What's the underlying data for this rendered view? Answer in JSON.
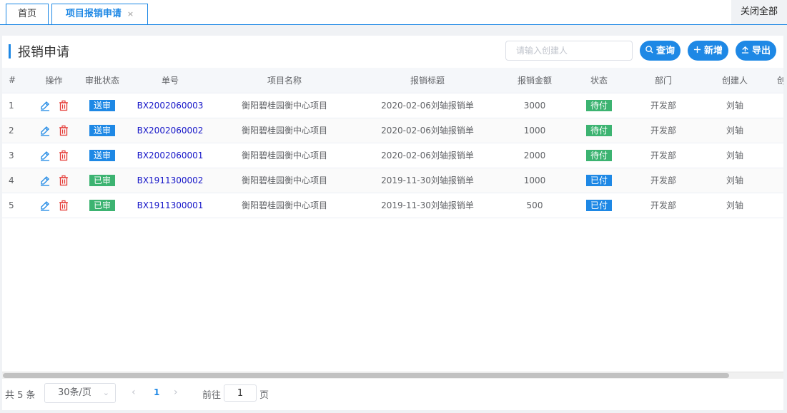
{
  "tabs": {
    "home": "首页",
    "active": "项目报销申请",
    "close_symbol": "×",
    "close_all": "关闭全部"
  },
  "panel": {
    "title": "报销申请",
    "search_placeholder": "请输入创建人",
    "buttons": {
      "query": "查询",
      "add": "新增",
      "export": "导出"
    }
  },
  "table": {
    "headers": [
      "#",
      "操作",
      "审批状态",
      "单号",
      "项目名称",
      "报销标题",
      "报销金额",
      "状态",
      "部门",
      "创建人",
      "创"
    ],
    "rows": [
      {
        "n": "1",
        "approval": "送审",
        "approval_color": "#1e88e5",
        "code": "BX2002060003",
        "project": "衡阳碧桂园衡中心项目",
        "title": "2020-02-06刘轴报销单",
        "amount": "3000",
        "status": "待付",
        "status_color": "#3cb371",
        "dept": "开发部",
        "creator": "刘轴"
      },
      {
        "n": "2",
        "approval": "送审",
        "approval_color": "#1e88e5",
        "code": "BX2002060002",
        "project": "衡阳碧桂园衡中心项目",
        "title": "2020-02-06刘轴报销单",
        "amount": "1000",
        "status": "待付",
        "status_color": "#3cb371",
        "dept": "开发部",
        "creator": "刘轴"
      },
      {
        "n": "3",
        "approval": "送审",
        "approval_color": "#1e88e5",
        "code": "BX2002060001",
        "project": "衡阳碧桂园衡中心项目",
        "title": "2020-02-06刘轴报销单",
        "amount": "2000",
        "status": "待付",
        "status_color": "#3cb371",
        "dept": "开发部",
        "creator": "刘轴"
      },
      {
        "n": "4",
        "approval": "已审",
        "approval_color": "#3cb371",
        "code": "BX1911300002",
        "project": "衡阳碧桂园衡中心项目",
        "title": "2019-11-30刘轴报销单",
        "amount": "1000",
        "status": "已付",
        "status_color": "#1e88e5",
        "dept": "开发部",
        "creator": "刘轴"
      },
      {
        "n": "5",
        "approval": "已审",
        "approval_color": "#3cb371",
        "code": "BX1911300001",
        "project": "衡阳碧桂园衡中心项目",
        "title": "2019-11-30刘轴报销单",
        "amount": "500",
        "status": "已付",
        "status_color": "#1e88e5",
        "dept": "开发部",
        "creator": "刘轴"
      }
    ]
  },
  "pager": {
    "total": "共 5 条",
    "page_size": "30条/页",
    "current_page": "1",
    "goto_label": "前往",
    "goto_value": "1",
    "page_unit": "页"
  },
  "colors": {
    "accent": "#1e88e5",
    "success": "#3cb371",
    "delete": "#e53935",
    "link": "#1515c8"
  }
}
